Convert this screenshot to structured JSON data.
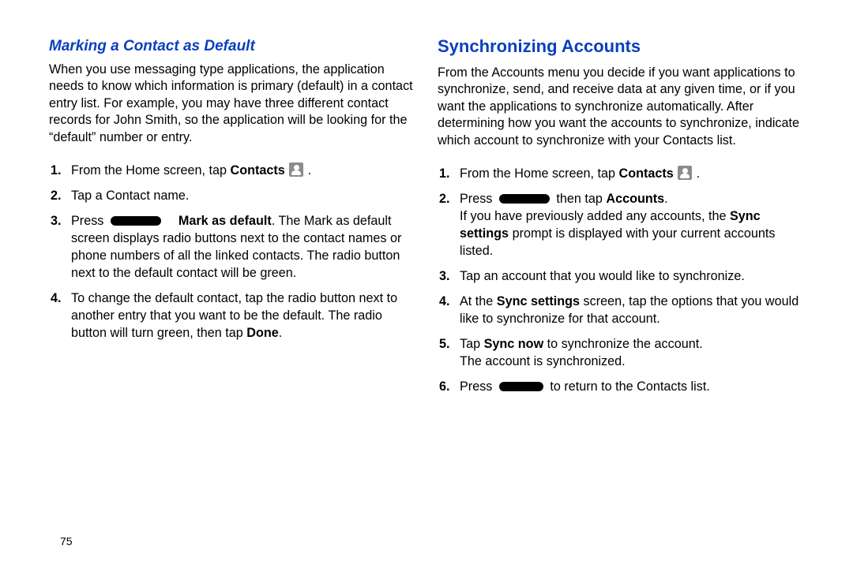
{
  "page_number": "75",
  "left": {
    "heading": "Marking a Contact as Default",
    "intro": "When you use messaging type applications, the application needs to know which information is primary (default) in a contact entry list. For example, you may have three different contact records for John Smith, so the application will be looking for the “default” number or entry.",
    "steps": {
      "s1a": "From the Home screen, tap ",
      "s1b": "Contacts",
      "s1c": " .",
      "s2": "Tap a Contact name.",
      "s3a": "Press ",
      "s3b": "Mark as default",
      "s3c": ". The Mark as default screen displays radio buttons next to the contact names or phone numbers of all the linked contacts. The radio button next to the default contact will be green.",
      "s4a": "To change the default contact, tap the radio button next to another entry that you want to be the default. The radio button will turn green, then tap ",
      "s4b": "Done",
      "s4c": "."
    }
  },
  "right": {
    "heading": "Synchronizing Accounts",
    "intro": "From the Accounts menu you decide if you want applications to synchronize, send, and receive data at any given time, or if you want the applications to synchronize automatically. After determining how you want the accounts to synchronize, indicate which account to synchronize with your Contacts list.",
    "steps": {
      "s1a": "From the Home screen, tap ",
      "s1b": "Contacts",
      "s1c": " .",
      "s2a": "Press ",
      "s2b": " then tap ",
      "s2c": "Accounts",
      "s2d": ".",
      "s2e": "If you have previously added any accounts, the ",
      "s2f": "Sync settings",
      "s2g": " prompt is displayed with your current accounts listed.",
      "s3": "Tap an account that you would like to synchronize.",
      "s4a": "At the ",
      "s4b": "Sync settings",
      "s4c": " screen, tap the options that you would like to synchronize for that account.",
      "s5a": "Tap ",
      "s5b": "Sync now",
      "s5c": " to synchronize the account.",
      "s5d": "The account is synchronized.",
      "s6a": "Press ",
      "s6b": " to return to the Contacts list."
    }
  }
}
